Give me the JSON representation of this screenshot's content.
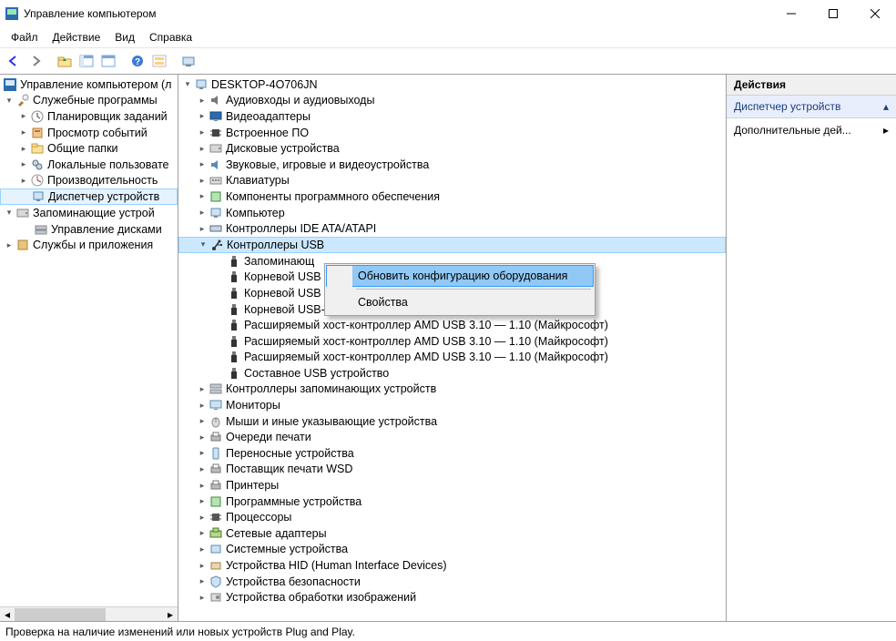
{
  "window": {
    "title": "Управление компьютером"
  },
  "menus": [
    "Файл",
    "Действие",
    "Вид",
    "Справка"
  ],
  "toolbar_icons": [
    "back",
    "forward",
    "up-folder",
    "list-view",
    "details",
    "refresh",
    "help",
    "properties",
    "computer"
  ],
  "left_tree": {
    "root": "Управление компьютером (л",
    "groups": [
      {
        "name": "Служебные программы",
        "items": [
          "Планировщик заданий",
          "Просмотр событий",
          "Общие папки",
          "Локальные пользовате",
          "Производительность",
          "Диспетчер устройств"
        ],
        "selected_index": 5
      },
      {
        "name": "Запоминающие устрой",
        "items": [
          "Управление дисками"
        ]
      }
    ],
    "footer": "Службы и приложения"
  },
  "device_tree": {
    "root": "DESKTOP-4O706JN",
    "categories": [
      {
        "label": "Аудиовходы и аудиовыходы",
        "icon": "audio"
      },
      {
        "label": "Видеоадаптеры",
        "icon": "display"
      },
      {
        "label": "Встроенное ПО",
        "icon": "chip"
      },
      {
        "label": "Дисковые устройства",
        "icon": "disk"
      },
      {
        "label": "Звуковые, игровые и видеоустройства",
        "icon": "sound"
      },
      {
        "label": "Клавиатуры",
        "icon": "keyboard"
      },
      {
        "label": "Компоненты программного обеспечения",
        "icon": "sw"
      },
      {
        "label": "Компьютер",
        "icon": "computer"
      },
      {
        "label": "Контроллеры IDE ATA/ATAPI",
        "icon": "ide"
      },
      {
        "label": "Контроллеры USB",
        "icon": "usb",
        "expanded": true,
        "selected": true,
        "children": [
          "Запоминающ",
          "Корневой USB",
          "Корневой USB",
          "Корневой USB-концентратор (USB 3.0)",
          "Расширяемый хост-контроллер AMD USB 3.10 — 1.10 (Майкрософт)",
          "Расширяемый хост-контроллер AMD USB 3.10 — 1.10 (Майкрософт)",
          "Расширяемый хост-контроллер AMD USB 3.10 — 1.10 (Майкрософт)",
          "Составное USB устройство"
        ]
      },
      {
        "label": "Контроллеры запоминающих устройств",
        "icon": "storage"
      },
      {
        "label": "Мониторы",
        "icon": "monitor"
      },
      {
        "label": "Мыши и иные указывающие устройства",
        "icon": "mouse"
      },
      {
        "label": "Очереди печати",
        "icon": "printer"
      },
      {
        "label": "Переносные устройства",
        "icon": "portable"
      },
      {
        "label": "Поставщик печати WSD",
        "icon": "wsd"
      },
      {
        "label": "Принтеры",
        "icon": "printer"
      },
      {
        "label": "Программные устройства",
        "icon": "sw"
      },
      {
        "label": "Процессоры",
        "icon": "cpu"
      },
      {
        "label": "Сетевые адаптеры",
        "icon": "net"
      },
      {
        "label": "Системные устройства",
        "icon": "sys"
      },
      {
        "label": "Устройства HID (Human Interface Devices)",
        "icon": "hid"
      },
      {
        "label": "Устройства безопасности",
        "icon": "sec"
      },
      {
        "label": "Устройства обработки изображений",
        "icon": "img"
      }
    ]
  },
  "context_menu": {
    "items": [
      "Обновить конфигурацию оборудования",
      "Свойства"
    ],
    "hovered_index": 0
  },
  "actions": {
    "header": "Действия",
    "section": "Диспетчер устройств",
    "more": "Дополнительные дей..."
  },
  "status": "Проверка на наличие изменений или новых устройств Plug and Play."
}
